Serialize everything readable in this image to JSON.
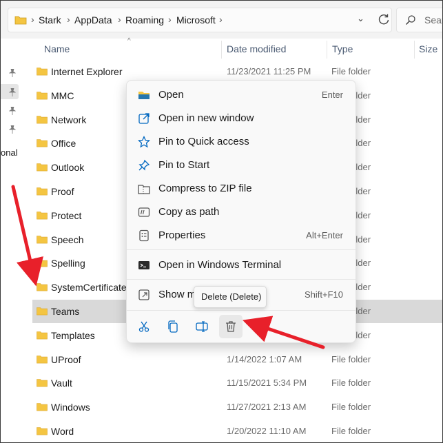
{
  "breadcrumb": {
    "items": [
      "Stark",
      "AppData",
      "Roaming",
      "Microsoft"
    ]
  },
  "search": {
    "placeholder": "Sear"
  },
  "nav": {
    "partial_label": "onal"
  },
  "columns": {
    "name": "Name",
    "date_modified": "Date modified",
    "type": "Type",
    "size": "Size"
  },
  "files": [
    {
      "name": "Internet Explorer",
      "date": "11/23/2021 11:25 PM",
      "type": "File folder"
    },
    {
      "name": "MMC",
      "date": "",
      "type": "File folder"
    },
    {
      "name": "Network",
      "date": "",
      "type": "File folder"
    },
    {
      "name": "Office",
      "date": "",
      "type": "File folder"
    },
    {
      "name": "Outlook",
      "date": "",
      "type": "File folder"
    },
    {
      "name": "Proof",
      "date": "",
      "type": "File folder"
    },
    {
      "name": "Protect",
      "date": "",
      "type": "File folder"
    },
    {
      "name": "Speech",
      "date": "",
      "type": "File folder"
    },
    {
      "name": "Spelling",
      "date": "",
      "type": "File folder"
    },
    {
      "name": "SystemCertificates",
      "date": "",
      "type": "File folder"
    },
    {
      "name": "Teams",
      "date": "",
      "type": "File folder",
      "selected": true
    },
    {
      "name": "Templates",
      "date": "",
      "type": "File folder"
    },
    {
      "name": "UProof",
      "date": "1/14/2022 1:07 AM",
      "type": "File folder"
    },
    {
      "name": "Vault",
      "date": "11/15/2021 5:34 PM",
      "type": "File folder"
    },
    {
      "name": "Windows",
      "date": "11/27/2021 2:13 AM",
      "type": "File folder"
    },
    {
      "name": "Word",
      "date": "1/20/2022 11:10 AM",
      "type": "File folder"
    }
  ],
  "context_menu": {
    "items": [
      {
        "label": "Open",
        "shortcut": "Enter",
        "icon": "folder-icon"
      },
      {
        "label": "Open in new window",
        "shortcut": "",
        "icon": "open-new-window-icon"
      },
      {
        "label": "Pin to Quick access",
        "shortcut": "",
        "icon": "star-icon"
      },
      {
        "label": "Pin to Start",
        "shortcut": "",
        "icon": "pin-icon"
      },
      {
        "label": "Compress to ZIP file",
        "shortcut": "",
        "icon": "zip-icon"
      },
      {
        "label": "Copy as path",
        "shortcut": "",
        "icon": "copy-path-icon"
      },
      {
        "label": "Properties",
        "shortcut": "Alt+Enter",
        "icon": "properties-icon"
      },
      {
        "label": "Open in Windows Terminal",
        "shortcut": "",
        "icon": "terminal-icon"
      },
      {
        "label": "Show m",
        "shortcut": "Shift+F10",
        "icon": "more-options-icon"
      }
    ],
    "quick_actions": [
      "cut-icon",
      "copy-icon",
      "rename-icon",
      "delete-icon"
    ],
    "tooltip": "Delete (Delete)"
  },
  "colors": {
    "folder": "#f4c542",
    "accent": "#0067c0",
    "annotation_arrow": "#e8202a"
  }
}
